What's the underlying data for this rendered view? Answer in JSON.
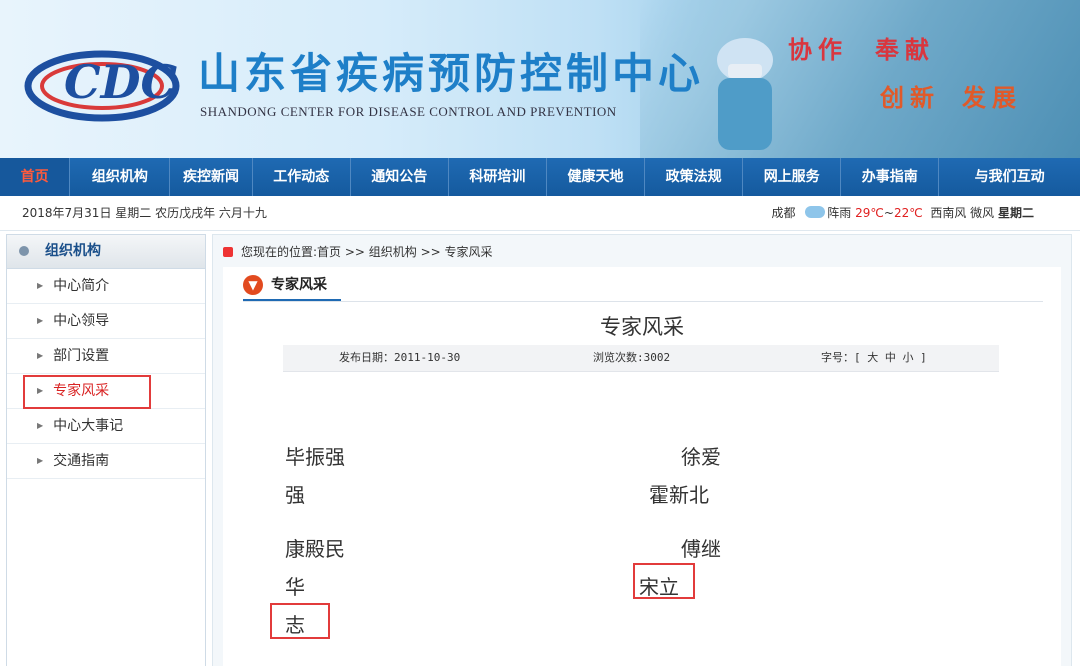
{
  "banner": {
    "title": "山东省疾病预防控制中心",
    "subtitle": "SHANDONG CENTER FOR DISEASE CONTROL AND PREVENTION",
    "slogans": [
      "协作",
      "奉献",
      "创新",
      "发展"
    ],
    "logo_text": "CDC"
  },
  "nav": {
    "items": [
      "首页",
      "组织机构",
      "疾控新闻",
      "工作动态",
      "通知公告",
      "科研培训",
      "健康天地",
      "政策法规",
      "网上服务",
      "办事指南",
      "与我们互动"
    ],
    "active": "首页"
  },
  "datebar": {
    "date": "2018年7月31日 星期二 农历戊戌年 六月十九",
    "city": "成都",
    "weather": "阵雨",
    "temp_high": "29℃",
    "temp_sep": "~",
    "temp_low": "22℃",
    "wind": "西南风 微风",
    "weekday": "星期二"
  },
  "sidebar": {
    "heading": "组织机构",
    "items": [
      "中心简介",
      "中心领导",
      "部门设置",
      "专家风采",
      "中心大事记",
      "交通指南"
    ],
    "active": "专家风采"
  },
  "breadcrumb": {
    "text": "您现在的位置:首页 >> 组织机构 >> 专家风采"
  },
  "article": {
    "tab": "专家风采",
    "title": "专家风采",
    "publish": "发布日期：2011-10-30",
    "views": "浏览次数:3002",
    "fontsize": "字号：[ 大 中 小 ]",
    "names": {
      "n1": "毕振强",
      "n2": "徐爱",
      "n3": "强",
      "n4": "霍新北",
      "n5": "康殿民",
      "n6": "傅继",
      "n7": "华",
      "n8": "宋立",
      "n9": "志"
    }
  }
}
